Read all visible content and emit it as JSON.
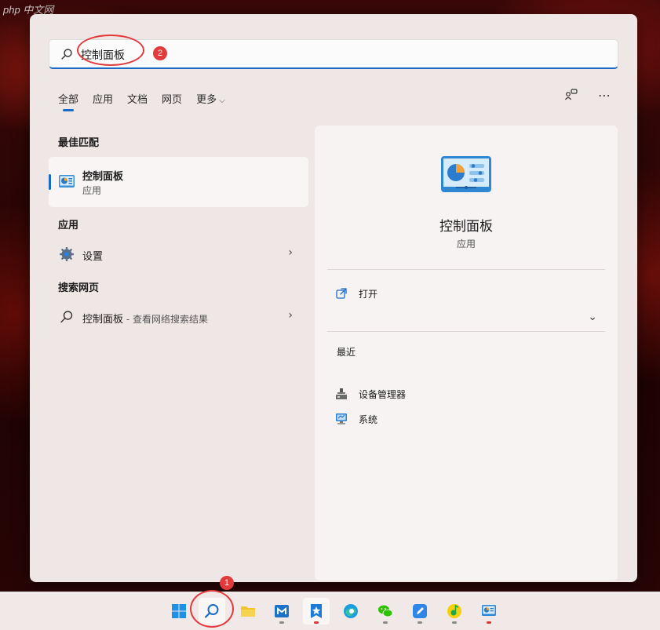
{
  "watermark": "php 中文网",
  "search": {
    "value": "控制面板",
    "annotation_number": "2"
  },
  "tabs": [
    {
      "label": "全部",
      "active": true
    },
    {
      "label": "应用"
    },
    {
      "label": "文档"
    },
    {
      "label": "网页"
    },
    {
      "label": "更多"
    }
  ],
  "top_icons": [
    "share-accounts-icon",
    "more-options-icon"
  ],
  "sections": {
    "best_match": "最佳匹配",
    "apps": "应用",
    "web": "搜索网页"
  },
  "best_match": {
    "name": "控制面板",
    "type": "应用"
  },
  "apps_list": [
    {
      "label": "设置",
      "icon": "gear-icon"
    }
  ],
  "web_list": [
    {
      "label": "控制面板",
      "suffix": " - 查看网络搜索结果",
      "icon": "search-icon"
    }
  ],
  "details": {
    "title": "控制面板",
    "subtitle": "应用",
    "actions": [
      {
        "label": "打开",
        "icon": "open-external-icon"
      }
    ],
    "recent_title": "最近",
    "recent": [
      {
        "label": "设备管理器",
        "icon": "device-manager-icon"
      },
      {
        "label": "系统",
        "icon": "system-monitor-icon"
      }
    ]
  },
  "taskbar": {
    "annotation_number": "1",
    "items": [
      "windows-start",
      "search",
      "file-explorer",
      "store-app",
      "favorites-app",
      "edge-browser",
      "wechat",
      "editor-app",
      "music-app",
      "control-panel"
    ]
  },
  "colors": {
    "accent": "#1a6bc8",
    "annotation": "#e23a3a"
  }
}
